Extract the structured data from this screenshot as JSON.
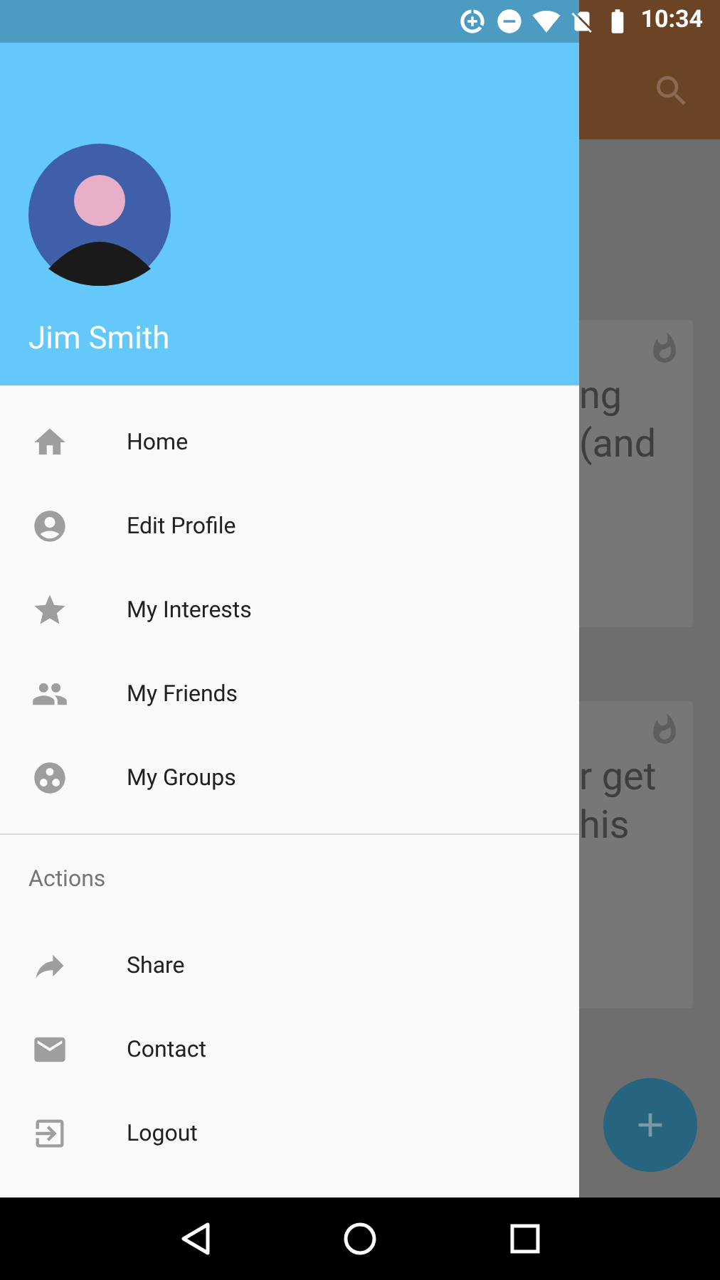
{
  "status_bar": {
    "time": "10:34"
  },
  "background": {
    "cards": [
      {
        "text_lines": [
          "ng",
          "(and"
        ]
      },
      {
        "text_lines": [
          "r get",
          "his"
        ]
      }
    ]
  },
  "drawer": {
    "user": {
      "name": "Jim Smith"
    },
    "items": [
      {
        "label": "Home"
      },
      {
        "label": "Edit Profile"
      },
      {
        "label": "My Interests"
      },
      {
        "label": "My Friends"
      },
      {
        "label": "My Groups"
      }
    ],
    "section_title": "Actions",
    "actions": [
      {
        "label": "Share"
      },
      {
        "label": "Contact"
      },
      {
        "label": "Logout"
      }
    ]
  }
}
